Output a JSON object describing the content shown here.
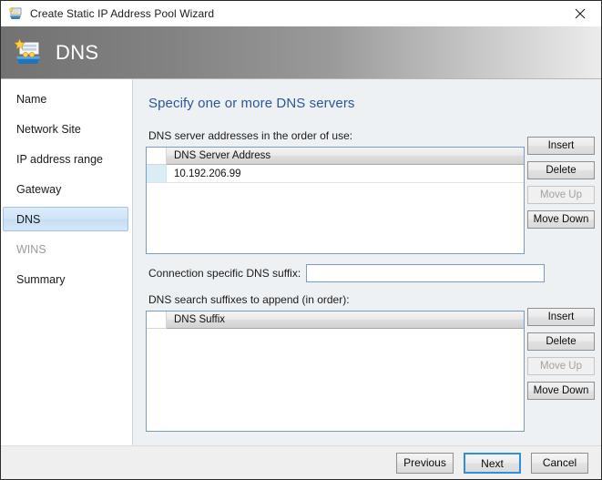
{
  "window": {
    "title": "Create Static IP Address Pool Wizard",
    "title_icon": "wizard-icon",
    "close_icon": "close-icon"
  },
  "banner": {
    "title": "DNS",
    "icon": "dns-wizard-icon"
  },
  "sidebar": {
    "items": [
      {
        "label": "Name",
        "state": "normal"
      },
      {
        "label": "Network Site",
        "state": "normal"
      },
      {
        "label": "IP address range",
        "state": "normal"
      },
      {
        "label": "Gateway",
        "state": "normal"
      },
      {
        "label": "DNS",
        "state": "selected"
      },
      {
        "label": "WINS",
        "state": "disabled"
      },
      {
        "label": "Summary",
        "state": "normal"
      }
    ]
  },
  "main": {
    "heading": "Specify one or more DNS servers",
    "servers_label": "DNS server addresses in the order of use:",
    "servers_grid": {
      "column_header": "DNS Server Address",
      "rows": [
        {
          "address": "10.192.206.99",
          "selected": true
        }
      ]
    },
    "servers_buttons": [
      {
        "label": "Insert",
        "enabled": true
      },
      {
        "label": "Delete",
        "enabled": true
      },
      {
        "label": "Move Up",
        "enabled": false
      },
      {
        "label": "Move Down",
        "enabled": true
      }
    ],
    "connection_suffix": {
      "label": "Connection specific DNS suffix:",
      "value": "",
      "placeholder": ""
    },
    "suffixes_label": "DNS search suffixes to append (in order):",
    "suffixes_grid": {
      "column_header": "DNS Suffix",
      "rows": []
    },
    "suffixes_buttons": [
      {
        "label": "Insert",
        "enabled": true
      },
      {
        "label": "Delete",
        "enabled": true
      },
      {
        "label": "Move Up",
        "enabled": false
      },
      {
        "label": "Move Down",
        "enabled": true
      }
    ]
  },
  "footer": {
    "previous_label": "Previous",
    "next_label": "Next",
    "cancel_label": "Cancel"
  },
  "colors": {
    "heading": "#2b5797",
    "selected_nav": "#cfe4f7",
    "default_button_border": "#2f8fd8",
    "content_background": "#eef1f4",
    "grid_border": "#7a9cbf"
  }
}
